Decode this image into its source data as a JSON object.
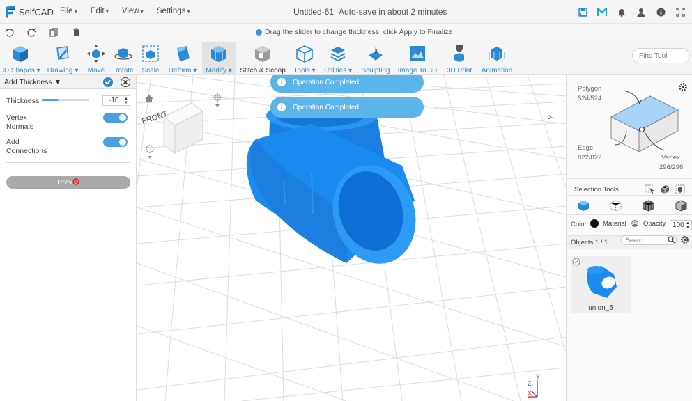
{
  "app": {
    "name": "SelfCAD"
  },
  "menu": [
    "File",
    "Edit",
    "View",
    "Settings"
  ],
  "document": {
    "title": "Untitled-61",
    "autosave": "Auto-save in about 2 minutes"
  },
  "hint": "Drag the slider to change thickness, click Apply to Finalize",
  "toolbar": {
    "tools": [
      {
        "label": "3D Shapes",
        "dropdown": true
      },
      {
        "label": "Drawing",
        "dropdown": true
      },
      {
        "label": "Move"
      },
      {
        "label": "Rotate"
      },
      {
        "label": "Scale"
      },
      {
        "label": "Deform",
        "dropdown": true
      },
      {
        "label": "Modify",
        "dropdown": true,
        "active": true
      },
      {
        "label": "Stitch & Scoop"
      },
      {
        "label": "Tools",
        "dropdown": true
      },
      {
        "label": "Utilities",
        "dropdown": true
      },
      {
        "label": "Sculpting"
      },
      {
        "label": "Image To 3D"
      },
      {
        "label": "3D Print"
      },
      {
        "label": "Animation"
      }
    ],
    "find_placeholder": "Find Tool"
  },
  "left_panel": {
    "title": "Add Thickness",
    "thickness_label": "Thickness",
    "thickness_value": "-10",
    "thickness_slider_level": 0.35,
    "vertex_normals_label_1": "Vertex",
    "vertex_normals_label_2": "Normals",
    "vertex_normals_on": true,
    "add_connections_label_1": "Add",
    "add_connections_label_2": "Connections",
    "add_connections_on": true,
    "preview_button": "Prev"
  },
  "viewport": {
    "view_cube_face": "FRONT",
    "toasts": [
      "Operation Completed",
      "Operation Completed"
    ],
    "axis_labels": {
      "x": "X",
      "y": "Y",
      "z": "Z"
    }
  },
  "right_panel": {
    "polygon_label": "Polygon",
    "polygon_count": "524/524",
    "edge_label": "Edge",
    "edge_count": "822/822",
    "vertex_label": "Vertex",
    "vertex_count": "296/296",
    "selection_tools_label": "Selection Tools",
    "color_label": "Color",
    "material_label": "Material",
    "opacity_label": "Opacity",
    "opacity_value": "100",
    "objects_label": "Objects 1 / 1",
    "search_placeholder": "Search",
    "object_name": "union_5"
  },
  "colors": {
    "accent": "#2c8ad4",
    "model": "#1a8cf0",
    "toast": "#5bb5ea"
  }
}
